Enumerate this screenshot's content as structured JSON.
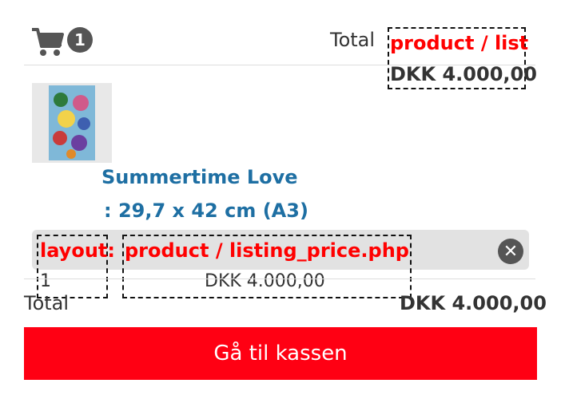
{
  "header": {
    "cart_count": "1",
    "total_label": "Total",
    "debug_label": "product / list",
    "total_price": "DKK 4.000,00"
  },
  "product": {
    "name": "Summertime Love",
    "size": ": 29,7 x 42 cm (A3)",
    "debug_layout_label": "layout:",
    "debug_price_label": "product / listing_price.php",
    "quantity": "1",
    "line_price": "DKK 4.000,00"
  },
  "footer": {
    "total_label": "Total",
    "total_price": "DKK 4.000,00",
    "checkout_label": "Gå til kassen"
  },
  "icons": {
    "cart": "shopping-cart-icon",
    "remove": "remove-circle-icon"
  },
  "colors": {
    "link": "#1e6fa3",
    "checkout": "#ff0013",
    "debug_text": "#ff0000"
  }
}
